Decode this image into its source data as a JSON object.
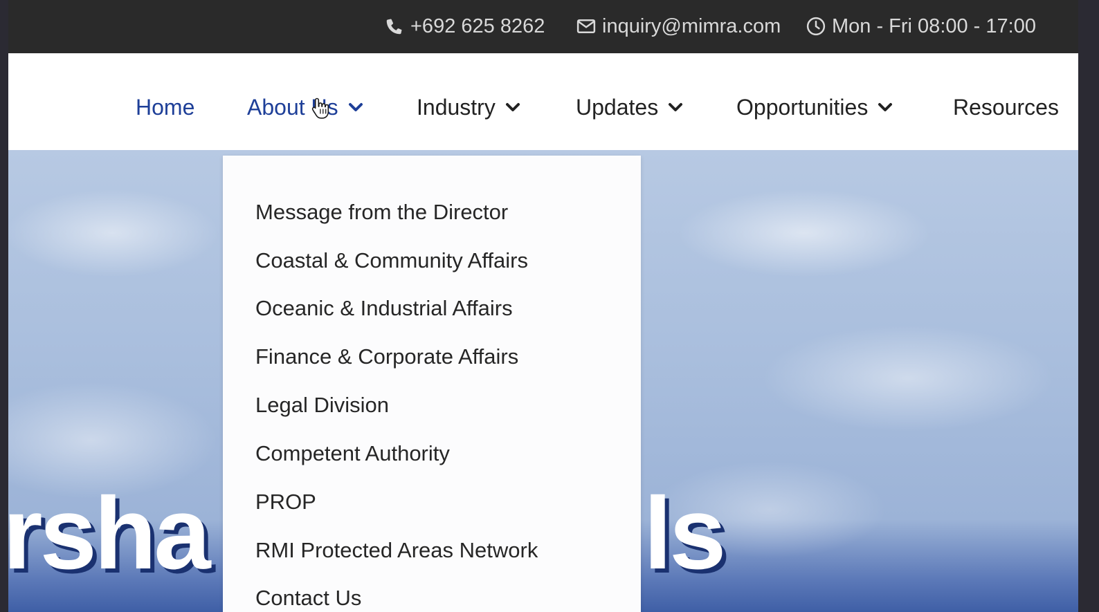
{
  "topbar": {
    "phone": "+692 625 8262",
    "email": "inquiry@mimra.com",
    "hours": "Mon - Fri 08:00 - 17:00",
    "icons": [
      "phone-icon",
      "envelope-icon",
      "clock-icon"
    ]
  },
  "nav": {
    "items": [
      {
        "label": "Home",
        "active": true,
        "has_dropdown": false
      },
      {
        "label": "About Us",
        "active": false,
        "has_dropdown": true
      },
      {
        "label": "Industry",
        "active": false,
        "has_dropdown": true
      },
      {
        "label": "Updates",
        "active": false,
        "has_dropdown": true
      },
      {
        "label": "Opportunities",
        "active": false,
        "has_dropdown": true
      },
      {
        "label": "Resources",
        "active": false,
        "has_dropdown": false
      }
    ]
  },
  "dropdown": {
    "items": [
      "Message from the Director",
      "Coastal & Community Affairs",
      "Oceanic & Industrial Affairs",
      "Finance & Corporate Affairs",
      "Legal Division",
      "Competent Authority",
      "PROP",
      "RMI Protected Areas Network",
      "Contact Us"
    ]
  },
  "hero": {
    "text_left": "rsha",
    "text_right": "ls"
  },
  "colors": {
    "topbar_bg": "#2a2a2a",
    "accent": "#1e3f98",
    "nav_text": "#222222"
  }
}
